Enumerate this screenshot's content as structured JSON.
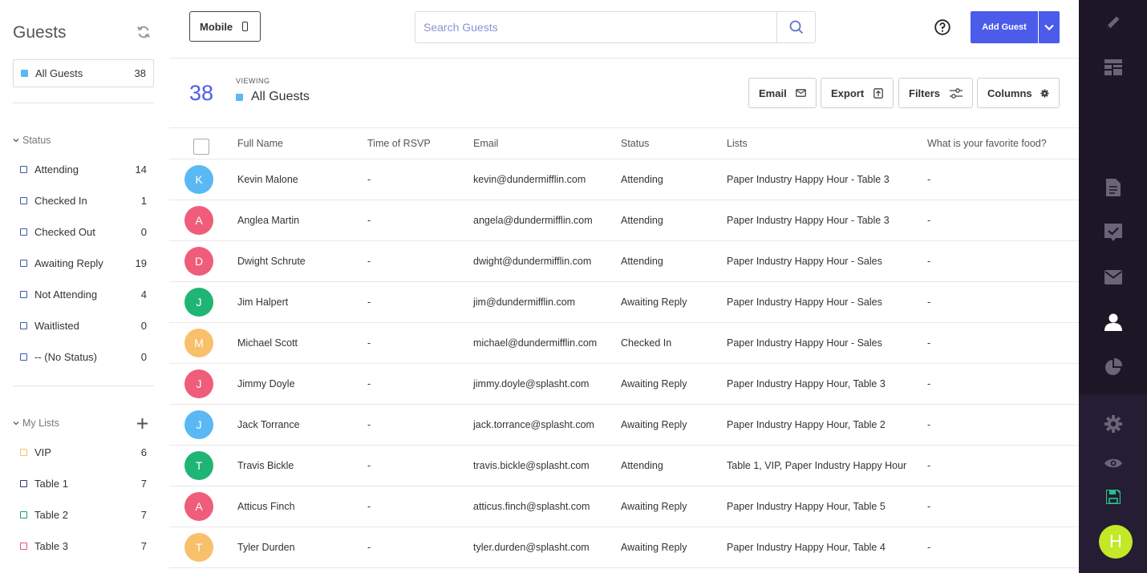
{
  "sidebar": {
    "title": "Guests",
    "all_guests": {
      "label": "All Guests",
      "count": "38",
      "color": "#5ab8f5"
    },
    "status_section": "Status",
    "status_items": [
      {
        "label": "Attending",
        "count": "14"
      },
      {
        "label": "Checked In",
        "count": "1"
      },
      {
        "label": "Checked Out",
        "count": "0"
      },
      {
        "label": "Awaiting Reply",
        "count": "19"
      },
      {
        "label": "Not Attending",
        "count": "4"
      },
      {
        "label": "Waitlisted",
        "count": "0"
      },
      {
        "label": "-- (No Status)",
        "count": "0"
      }
    ],
    "lists_section": "My Lists",
    "list_items": [
      {
        "label": "VIP",
        "count": "6",
        "color": "#f0c36a"
      },
      {
        "label": "Table 1",
        "count": "7",
        "color": "#2d3a6e"
      },
      {
        "label": "Table 2",
        "count": "7",
        "color": "#1a9e76"
      },
      {
        "label": "Table 3",
        "count": "7",
        "color": "#e8556d"
      }
    ]
  },
  "topbar": {
    "mobile_label": "Mobile",
    "search_placeholder": "Search Guests",
    "add_guest_label": "Add Guest"
  },
  "view": {
    "count": "38",
    "viewing_label": "VIEWING",
    "name": "All Guests",
    "buttons": {
      "email": "Email",
      "export": "Export",
      "filters": "Filters",
      "columns": "Columns"
    }
  },
  "table": {
    "headers": {
      "full_name": "Full Name",
      "time_rsvp": "Time of RSVP",
      "email": "Email",
      "status": "Status",
      "lists": "Lists",
      "food": "What is your favorite food?"
    },
    "rows": [
      {
        "initial": "K",
        "color": "#5ab8f5",
        "name": "Kevin Malone",
        "time": "-",
        "email": "kevin@dundermifflin.com",
        "status": "Attending",
        "lists": "Paper Industry Happy Hour - Table 3",
        "food": "-"
      },
      {
        "initial": "A",
        "color": "#ef5d7a",
        "name": "Anglea Martin",
        "time": "-",
        "email": "angela@dundermifflin.com",
        "status": "Attending",
        "lists": "Paper Industry Happy Hour - Table 3",
        "food": "-"
      },
      {
        "initial": "D",
        "color": "#ef5d7a",
        "name": "Dwight Schrute",
        "time": "-",
        "email": "dwight@dundermifflin.com",
        "status": "Attending",
        "lists": "Paper Industry Happy Hour - Sales",
        "food": "-"
      },
      {
        "initial": "J",
        "color": "#1fb574",
        "name": "Jim Halpert",
        "time": "-",
        "email": "jim@dundermifflin.com",
        "status": "Awaiting Reply",
        "lists": "Paper Industry Happy Hour - Sales",
        "food": "-"
      },
      {
        "initial": "M",
        "color": "#f9c06b",
        "name": "Michael Scott",
        "time": "-",
        "email": "michael@dundermifflin.com",
        "status": "Checked In",
        "lists": "Paper Industry Happy Hour - Sales",
        "food": "-"
      },
      {
        "initial": "J",
        "color": "#ef5d7a",
        "name": "Jimmy Doyle",
        "time": "-",
        "email": "jimmy.doyle@splasht.com",
        "status": "Awaiting Reply",
        "lists": "Paper Industry Happy Hour, Table 3",
        "food": "-"
      },
      {
        "initial": "J",
        "color": "#5ab8f5",
        "name": "Jack Torrance",
        "time": "-",
        "email": "jack.torrance@splasht.com",
        "status": "Awaiting Reply",
        "lists": "Paper Industry Happy Hour, Table 2",
        "food": "-"
      },
      {
        "initial": "T",
        "color": "#1fb574",
        "name": "Travis Bickle",
        "time": "-",
        "email": "travis.bickle@splasht.com",
        "status": "Attending",
        "lists": "Table 1, VIP, Paper Industry Happy Hour",
        "food": "-"
      },
      {
        "initial": "A",
        "color": "#ef5d7a",
        "name": "Atticus Finch",
        "time": "-",
        "email": "atticus.finch@splasht.com",
        "status": "Awaiting Reply",
        "lists": "Paper Industry Happy Hour, Table 5",
        "food": "-"
      },
      {
        "initial": "T",
        "color": "#f9c06b",
        "name": "Tyler Durden",
        "time": "-",
        "email": "tyler.durden@splasht.com",
        "status": "Awaiting Reply",
        "lists": "Paper Industry Happy Hour, Table 4",
        "food": "-"
      }
    ]
  },
  "rail": {
    "user_initial": "H",
    "icons": [
      "pencil-icon",
      "layout-icon",
      "document-icon",
      "checkbox-icon",
      "mail-icon",
      "person-icon",
      "pie-chart-icon",
      "gear-icon",
      "eye-icon",
      "save-icon"
    ]
  }
}
